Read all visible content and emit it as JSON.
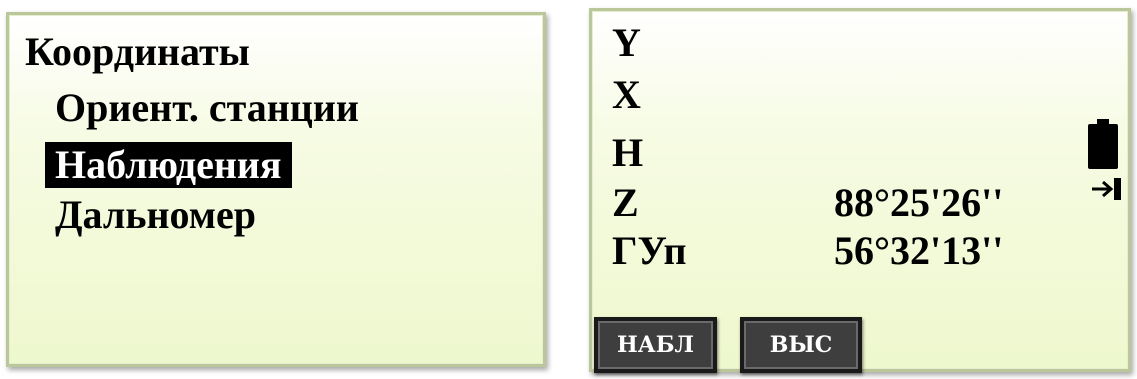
{
  "left_screen": {
    "title": "Координаты",
    "menu_items": [
      {
        "label": "Ориент. станции",
        "selected": false
      },
      {
        "label": "Наблюдения",
        "selected": true
      },
      {
        "label": "Дальномер",
        "selected": false
      }
    ]
  },
  "right_screen": {
    "rows": [
      {
        "label": "Y",
        "value": ""
      },
      {
        "label": "X",
        "value": ""
      },
      {
        "label": "H",
        "value": ""
      },
      {
        "label": "Z",
        "value": "88°25'26''"
      },
      {
        "label": "ГУп",
        "value": "56°32'13''"
      }
    ],
    "icons": [
      "battery-icon",
      "arrow-to-bar-icon"
    ],
    "softkeys": [
      "НАБЛ",
      "ВЫС"
    ]
  },
  "colors": {
    "panel_border": "#b9c79b",
    "panel_bg_bottom": "#eef8cd",
    "selection_bg": "#000000",
    "softkey_bg": "#3e3e3e"
  }
}
